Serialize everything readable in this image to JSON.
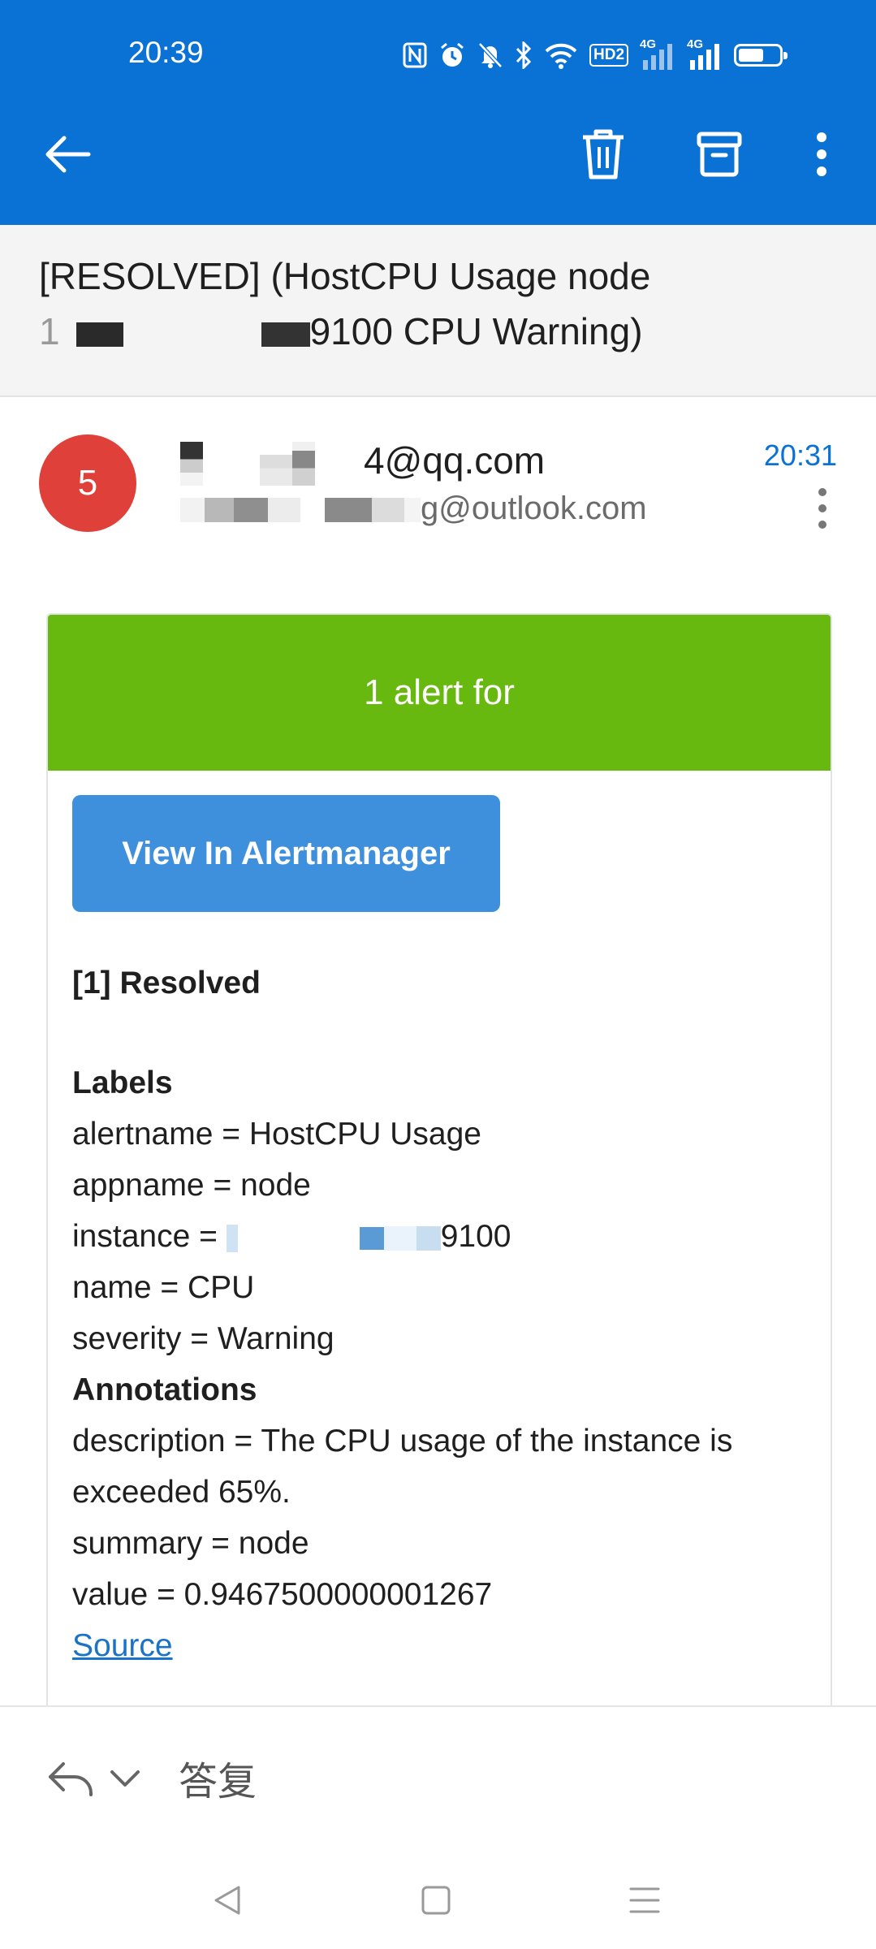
{
  "status_bar": {
    "time": "20:39",
    "icons": [
      "nfc-icon",
      "alarm-icon",
      "mute-icon",
      "bluetooth-icon",
      "wifi-icon",
      "hd-icon",
      "signal-4g-icon",
      "signal-4g-icon",
      "battery-icon"
    ],
    "hd_label": "HD2",
    "net_label_1": "4G",
    "net_label_2": "4G",
    "battery_level": 0.55
  },
  "app_bar": {
    "actions": [
      "back-icon",
      "delete-icon",
      "archive-icon",
      "more-icon"
    ],
    "color": "#0a72d4"
  },
  "subject": {
    "line1": "[RESOLVED]  (HostCPU Usage node",
    "line2_prefix": "1",
    "line2_suffix": "9100 CPU Warning)"
  },
  "message": {
    "avatar_text": "5",
    "avatar_color": "#e0403a",
    "from_suffix": "4@qq.com",
    "to_suffix": "g@outlook.com",
    "time": "20:31"
  },
  "email_body": {
    "header": "1 alert for",
    "header_color": "#68b90f",
    "button_label": "View In Alertmanager",
    "button_color": "#3e8fdc",
    "resolved_heading": "[1] Resolved",
    "labels_heading": "Labels",
    "labels": {
      "alertname": "alertname = HostCPU Usage",
      "appname": "appname = node",
      "instance_prefix": "instance = ",
      "instance_suffix": "9100",
      "name": "name = CPU",
      "severity": "severity = Warning"
    },
    "annotations_heading": "Annotations",
    "annotations": {
      "description_1": "description = The CPU usage of the instance is",
      "description_2": "exceeded 65%.",
      "summary": "summary = node",
      "value": "value = 0.9467500000001267"
    },
    "source_link": "Source"
  },
  "reply_bar": {
    "label": "答复"
  },
  "nav_bar": {
    "buttons": [
      "nav-back-icon",
      "nav-home-icon",
      "nav-menu-icon"
    ]
  }
}
